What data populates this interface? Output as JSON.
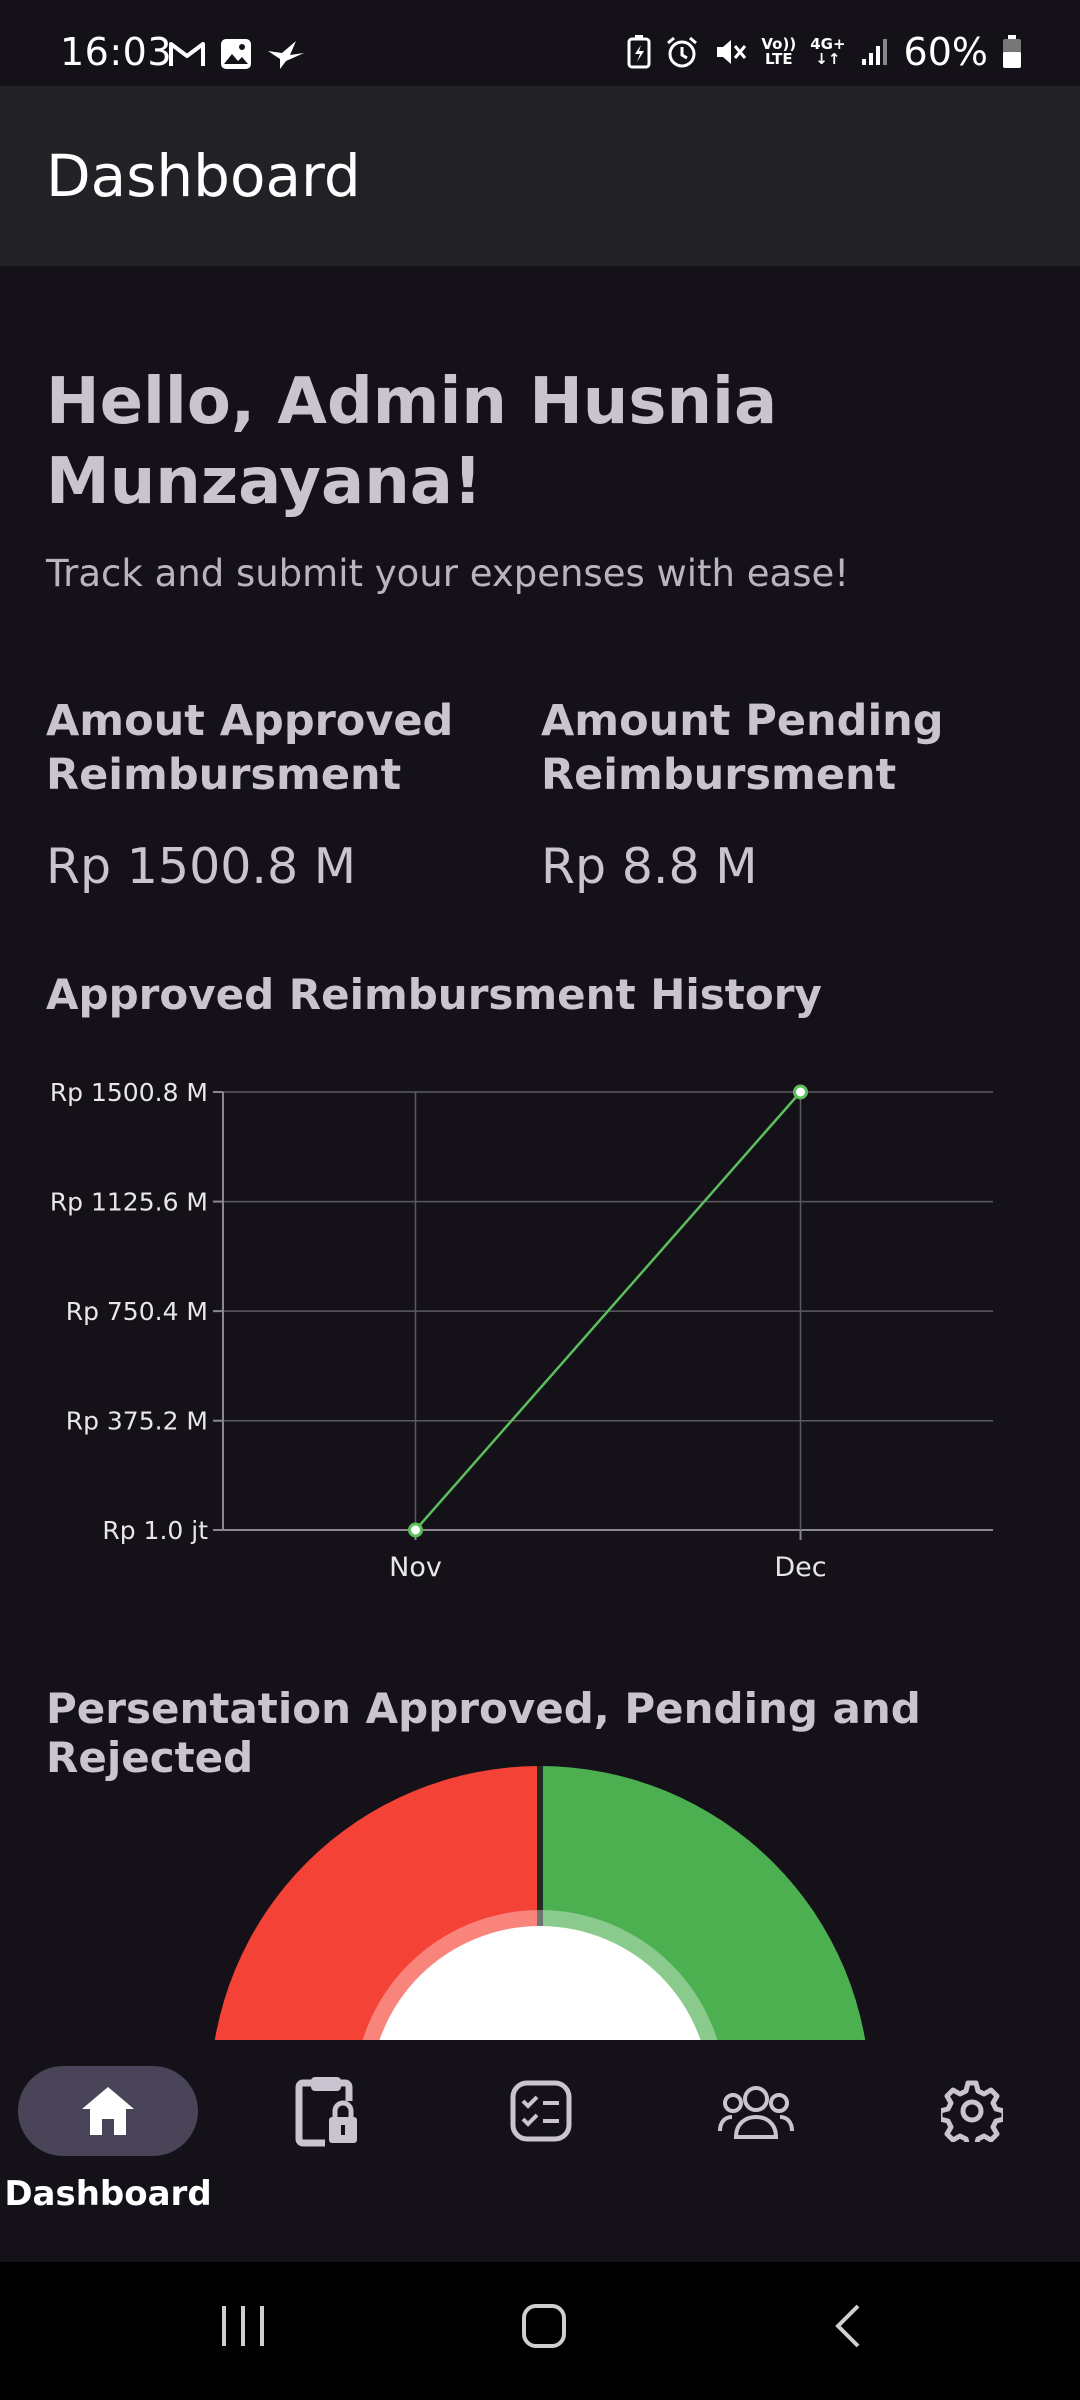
{
  "status_bar": {
    "time": "16:03",
    "battery": "60%",
    "left_icons": [
      "gmail-icon",
      "gallery-icon",
      "bird-app-icon"
    ],
    "right_icons": [
      "battery-saver-icon",
      "alarm-icon",
      "mute-icon",
      "volte-icon",
      "4g-icon",
      "signal-icon",
      "battery-icon"
    ],
    "volte_top": "Vo))",
    "volte_bottom": "LTE",
    "network_top": "4G+"
  },
  "app_bar": {
    "title": "Dashboard"
  },
  "greeting": {
    "title": "Hello, Admin Husnia Munzayana!",
    "subtitle": "Track and submit your expenses with ease!"
  },
  "stats": {
    "approved_label": "Amout Approved Reimbursment",
    "approved_value": "Rp 1500.8 M",
    "pending_label": "Amount Pending Reimbursment",
    "pending_value": "Rp 8.8 M"
  },
  "history_title": "Approved Reimbursment History",
  "chart_data": {
    "type": "line",
    "x": [
      "Nov",
      "Dec"
    ],
    "y_tick_labels": [
      "Rp 1.0 jt",
      "Rp 375.2 M",
      "Rp 750.4 M",
      "Rp 1125.6 M",
      "Rp 1500.8 M"
    ],
    "y_tick_values": [
      1.0,
      375.2,
      750.4,
      1125.6,
      1500.8
    ],
    "series": [
      {
        "values": [
          1.0,
          1500.8
        ],
        "color": "#5cbf5c"
      }
    ],
    "ylim": [
      1.0,
      1500.8
    ],
    "grid": true,
    "title": "",
    "xlabel": "",
    "ylabel": ""
  },
  "gauge_title": "Persentation Approved, Pending and Rejected",
  "gauge_data": {
    "type": "semi-donut",
    "segments": [
      {
        "color": "#f44336"
      },
      {
        "color": "#4caf50"
      }
    ]
  },
  "bottom_nav": {
    "items": [
      {
        "label": "Dashboard",
        "icon": "home-icon",
        "active": true
      },
      {
        "label": "",
        "icon": "clipboard-lock-icon",
        "active": false
      },
      {
        "label": "",
        "icon": "checklist-icon",
        "active": false
      },
      {
        "label": "",
        "icon": "users-icon",
        "active": false
      },
      {
        "label": "",
        "icon": "settings-icon",
        "active": false
      }
    ]
  },
  "system_nav": {
    "icons": [
      "recent-apps-icon",
      "home-button-icon",
      "back-icon"
    ]
  },
  "colors": {
    "background": "#141218",
    "app_bar": "#222125",
    "nav_pill": "#4a4458",
    "line": "#5cbf5c"
  }
}
